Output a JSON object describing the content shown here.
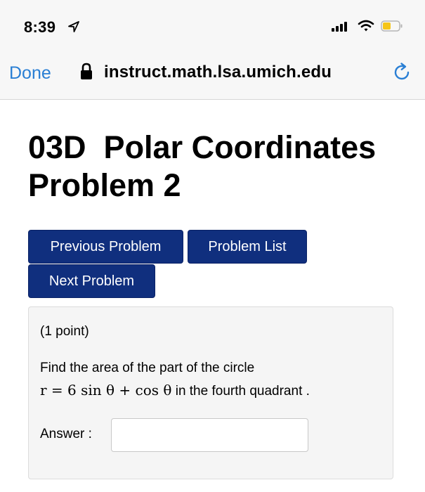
{
  "status_bar": {
    "time": "8:39",
    "icons": [
      "location-arrow-icon",
      "cellular-signal-icon",
      "wifi-icon",
      "battery-icon"
    ],
    "battery_color": "#f5c518"
  },
  "browser": {
    "done_label": "Done",
    "url": "instruct.math.lsa.umich.edu",
    "accent_color": "#2a7fd4"
  },
  "page": {
    "title_line1": "03D  Polar Coordinates",
    "title_line2": "Problem 2"
  },
  "nav_buttons": {
    "previous": "Previous Problem",
    "list": "Problem List",
    "next": "Next Problem",
    "color": "#102f7e"
  },
  "problem": {
    "points": "(1 point)",
    "question_line1": "Find the area of the part of the circle",
    "equation": "r = 6 sin θ + cos θ",
    "question_line2_suffix": " in the fourth quadrant .",
    "answer_label": "Answer :",
    "answer_value": ""
  }
}
